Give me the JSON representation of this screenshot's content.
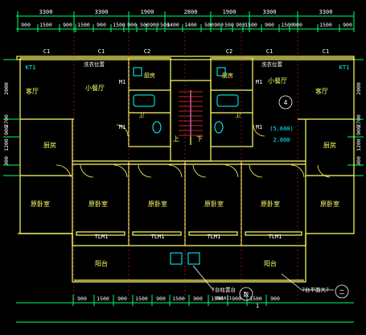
{
  "drawing": {
    "colors": {
      "background": "#000000",
      "wall": "#ffff66",
      "dim_line": "#00ff66",
      "dim_text": "#ffffff",
      "room_text": "#ffff66",
      "annotation": "#00ffff",
      "red": "#ff3333",
      "magenta": "#ff33ff",
      "gray": "#a0a0a0"
    },
    "top_dims_row1": [
      "3300",
      "3300",
      "1900",
      "2800",
      "1900",
      "3300",
      "3300"
    ],
    "top_dims_row2": [
      "900",
      "1500",
      "900",
      "1500",
      "900",
      "1500",
      "900",
      "500",
      "900",
      "500",
      "1400",
      "1400",
      "500",
      "900",
      "500",
      "900",
      "1500",
      "900",
      "1500",
      "900",
      "1500",
      "900"
    ],
    "bottom_dims": [
      "900",
      "1500",
      "900",
      "1500",
      "900",
      "1500",
      "900",
      "1500",
      "900",
      "1500",
      "900"
    ],
    "left_dims": [
      "2000",
      "2700",
      "900",
      "1200",
      "900"
    ],
    "right_dims": [
      "2000",
      "2700",
      "900",
      "1200",
      "900"
    ],
    "window_tags": [
      "C1",
      "C1",
      "C2",
      "C2",
      "C1",
      "C1"
    ],
    "window_tags_balcony": [
      "TLM1",
      "TLM1",
      "TLM1",
      "TLM1"
    ],
    "rooms": {
      "living_left": "客厅",
      "living_right": "客厅",
      "dining_left": "小餐厅",
      "dining_right": "小餐厅",
      "kitchen_left": "厨房",
      "kitchen_right": "厨房",
      "bath_left": "卫",
      "bath_right": "卫",
      "study_left": "厨房",
      "study_right": "厨房",
      "bedroom1": "原卧室",
      "bedroom2": "原卧室",
      "bedroom3": "原卧室",
      "bedroom4": "原卧室",
      "bedroom5": "原卧室",
      "bedroom6": "原卧室",
      "balcony_left": "阳台",
      "balcony_right": "阳台"
    },
    "labels": {
      "kt_left": "KT1",
      "kt_right": "KT1",
      "washer_left": "洗衣位置",
      "washer_right": "洗衣位置",
      "m1_a": "M1",
      "m1_b": "M1",
      "m1_c": "M1",
      "m1_d": "M1",
      "stair_up": "上",
      "stair_down": "下",
      "elevation_top": "(5.600)",
      "elevation_bottom": "2.800",
      "circle_number": "4",
      "note_left_line1": "7台柱置台",
      "note_left_line2": "B6SA11",
      "note_right": "7台平面大7",
      "circle_right": "二",
      "circle_left": "数",
      "small_label": "1"
    }
  }
}
